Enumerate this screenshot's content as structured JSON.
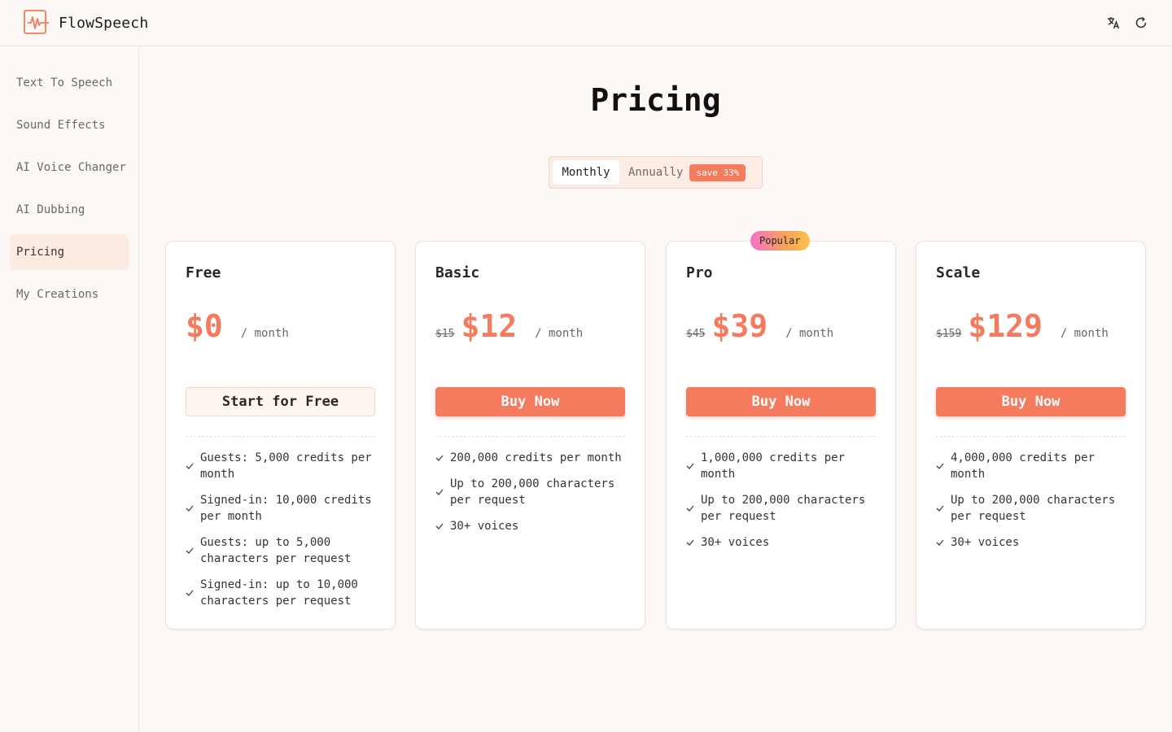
{
  "app": {
    "name": "FlowSpeech"
  },
  "header": {
    "icons": [
      "translate-icon",
      "refresh-icon"
    ]
  },
  "sidebar": {
    "items": [
      {
        "label": "Text To Speech",
        "active": false
      },
      {
        "label": "Sound Effects",
        "active": false
      },
      {
        "label": "AI Voice Changer",
        "active": false
      },
      {
        "label": "AI Dubbing",
        "active": false
      },
      {
        "label": "Pricing",
        "active": true
      },
      {
        "label": "My Creations",
        "active": false
      }
    ]
  },
  "main": {
    "title": "Pricing",
    "billing_toggle": {
      "monthly": "Monthly",
      "annually": "Annually",
      "save_badge": "save 33%",
      "selected": "Monthly"
    },
    "plans": [
      {
        "name": "Free",
        "old_price": "",
        "price": "$0",
        "period": "/ month",
        "cta": "Start for Free",
        "cta_style": "secondary",
        "badge": "",
        "features": [
          "Guests: 5,000 credits per month",
          "Signed-in: 10,000 credits per month",
          "Guests: up to 5,000 characters per request",
          "Signed-in: up to 10,000 characters per request"
        ]
      },
      {
        "name": "Basic",
        "old_price": "$15",
        "price": "$12",
        "period": "/ month",
        "cta": "Buy Now",
        "cta_style": "primary",
        "badge": "",
        "features": [
          "200,000 credits per month",
          "Up to 200,000 characters per request",
          "30+ voices"
        ]
      },
      {
        "name": "Pro",
        "old_price": "$45",
        "price": "$39",
        "period": "/ month",
        "cta": "Buy Now",
        "cta_style": "primary",
        "badge": "Popular",
        "features": [
          "1,000,000 credits per month",
          "Up to 200,000 characters per request",
          "30+ voices"
        ]
      },
      {
        "name": "Scale",
        "old_price": "$159",
        "price": "$129",
        "period": "/ month",
        "cta": "Buy Now",
        "cta_style": "primary",
        "badge": "",
        "features": [
          "4,000,000 credits per month",
          "Up to 200,000 characters per request",
          "30+ voices"
        ]
      }
    ]
  },
  "colors": {
    "accent": "#f47b5e",
    "background": "#fdf8f5",
    "active_nav": "#fbebe3"
  }
}
